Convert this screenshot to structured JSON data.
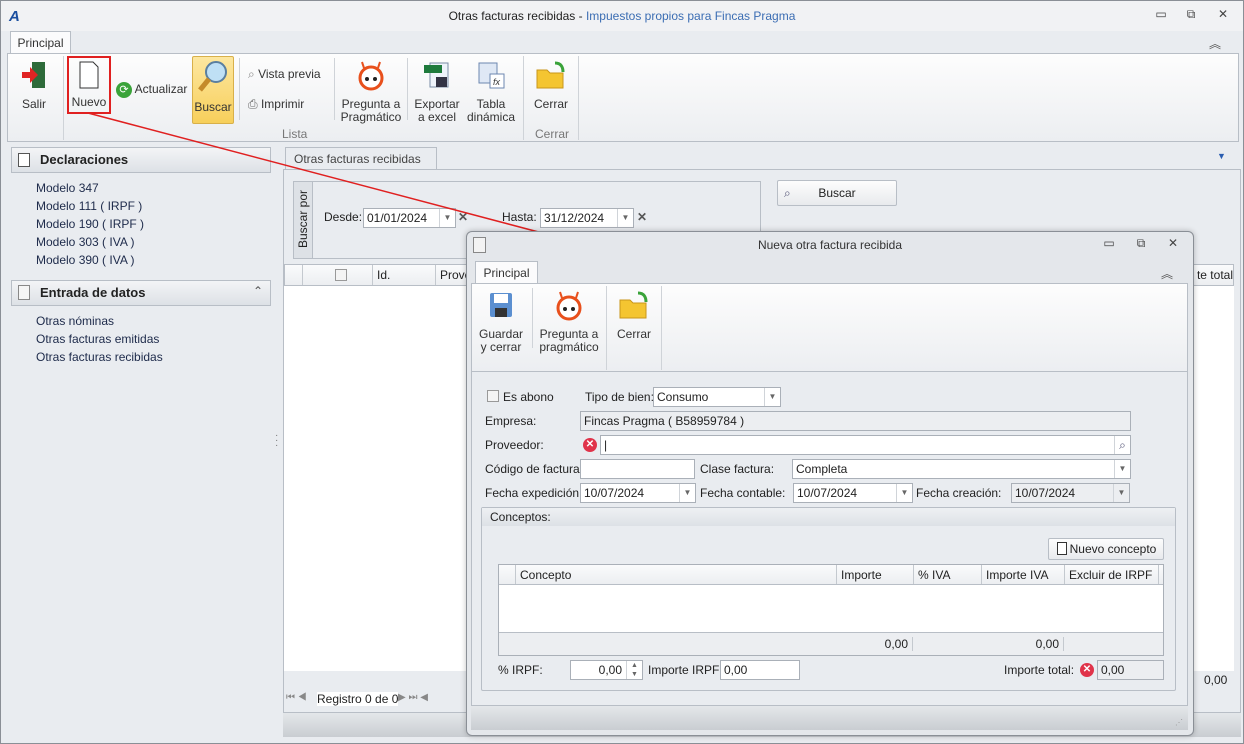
{
  "window": {
    "title": "Otras facturas recibidas",
    "title_sep": " - ",
    "subtitle": "Impuestos propios para  Fincas Pragma",
    "minimize": "▭",
    "restore": "⧉",
    "close": "✕",
    "collapse": "︽"
  },
  "ribbon": {
    "tab": "Principal",
    "buttons": {
      "salir": "Salir",
      "nuevo": "Nuevo",
      "actualizar": "Actualizar",
      "buscar": "Buscar",
      "vista_previa": "Vista previa",
      "imprimir": "Imprimir",
      "pregunta_1": "Pregunta a",
      "pregunta_2": "Pragmático",
      "exportar_1": "Exportar",
      "exportar_2": "a excel",
      "tabla_1": "Tabla",
      "tabla_2": "dinámica",
      "cerrar": "Cerrar"
    },
    "groups": {
      "lista": "Lista",
      "cerrar": "Cerrar"
    }
  },
  "sidebar": {
    "declaraciones": {
      "title": "Declaraciones",
      "items": [
        "Modelo 347",
        "Modelo 111 ( IRPF )",
        "Modelo 190 ( IRPF )",
        "Modelo 303 ( IVA )",
        "Modelo 390 ( IVA )"
      ]
    },
    "entrada": {
      "title": "Entrada de datos",
      "items": [
        "Otras nóminas",
        "Otras facturas emitidas",
        "Otras facturas recibidas"
      ]
    }
  },
  "main": {
    "tab": "Otras facturas recibidas",
    "search": {
      "group_label": "Buscar por",
      "desde_label": "Desde:",
      "desde": "01/01/2024",
      "hasta_label": "Hasta:",
      "hasta": "31/12/2024",
      "button": "Buscar"
    },
    "grid": {
      "columns": [
        "Id.",
        "Prove",
        "te total"
      ]
    },
    "footer_total": "0,00",
    "navigator": "Registro 0 de 0"
  },
  "dialog": {
    "title": "Nueva otra factura recibida",
    "tab": "Principal",
    "buttons": {
      "guardar_1": "Guardar",
      "guardar_2": "y cerrar",
      "pregunta_1": "Pregunta a",
      "pregunta_2": "pragmático",
      "cerrar": "Cerrar"
    },
    "form": {
      "es_abono": "Es abono",
      "tipo_bien_label": "Tipo de bien:",
      "tipo_bien": "Consumo",
      "empresa_label": "Empresa:",
      "empresa": "Fincas Pragma ( B58959784 )",
      "proveedor_label": "Proveedor:",
      "proveedor": "",
      "codigo_label": "Código de factura:",
      "codigo": "",
      "clase_label": "Clase factura:",
      "clase": "Completa",
      "fexp_label": "Fecha expedición:",
      "fexp": "10/07/2024",
      "fcont_label": "Fecha contable:",
      "fcont": "10/07/2024",
      "fcre_label": "Fecha creación:",
      "fcre": "10/07/2024"
    },
    "conceptos": {
      "title": "Conceptos:",
      "new_button": "Nuevo concepto",
      "columns": [
        "Concepto",
        "Importe",
        "% IVA",
        "Importe IVA",
        "Excluir de IRPF"
      ],
      "sum_importe": "0,00",
      "sum_iva": "0,00"
    },
    "irpf_label": "% IRPF:",
    "irpf": "0,00",
    "importe_irpf_label": "Importe IRPF:",
    "importe_irpf": "0,00",
    "total_label": "Importe total:",
    "total": "0,00"
  }
}
